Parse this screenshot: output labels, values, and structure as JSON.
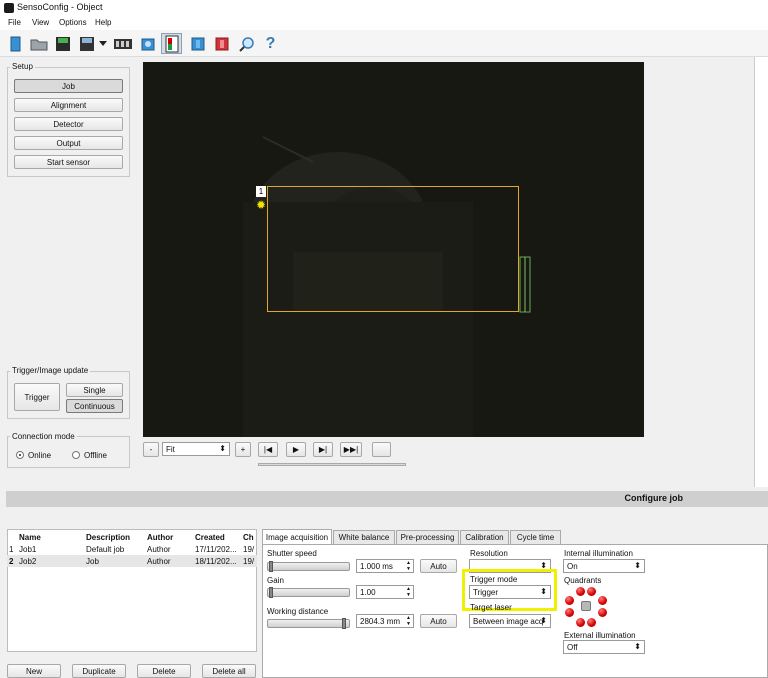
{
  "window": {
    "title": "SensoConfig - Object"
  },
  "menu": [
    "File",
    "View",
    "Options",
    "Help"
  ],
  "toolbar": {
    "icons": [
      "new-job-icon",
      "open-icon",
      "save-icon",
      "save-as-icon",
      "dropdown-icon",
      "film-icon",
      "camera-icon",
      "object-icon",
      "color-icon",
      "book-icon",
      "search-icon",
      "help-icon"
    ]
  },
  "setup": {
    "title": "Setup",
    "buttons": [
      "Job",
      "Alignment",
      "Detector",
      "Output",
      "Start sensor"
    ]
  },
  "trigger": {
    "title": "Trigger/Image update",
    "trigger_label": "Trigger",
    "single_label": "Single",
    "continuous_label": "Continuous"
  },
  "connection": {
    "title": "Connection mode",
    "online": "Online",
    "offline": "Offline"
  },
  "viewer": {
    "roi_number": "1",
    "zoom_value": "Fit",
    "minus": "-",
    "plus": "+"
  },
  "section": {
    "title": "Configure job"
  },
  "jobs": {
    "columns": [
      "",
      "Name",
      "Description",
      "Author",
      "Created",
      "Ch"
    ],
    "rows": [
      [
        "1",
        "Job1",
        "Default job",
        "Author",
        "17/11/202...",
        "19/"
      ],
      [
        "2",
        "Job2",
        "Job",
        "Author",
        "18/11/202...",
        "19/"
      ]
    ],
    "buttons": {
      "new": "New",
      "duplicate": "Duplicate",
      "delete": "Delete",
      "delete_all": "Delete all"
    }
  },
  "tabs": [
    "Image acquisition",
    "White balance",
    "Pre-processing",
    "Calibration",
    "Cycle time"
  ],
  "acquisition": {
    "shutter_label": "Shutter speed",
    "shutter_value": "1.000 ms",
    "gain_label": "Gain",
    "gain_value": "1.00",
    "working_distance_label": "Working distance",
    "working_distance_value": "2804.3 mm",
    "auto": "Auto",
    "resolution_label": "Resolution",
    "trigger_mode_label": "Trigger mode",
    "trigger_mode_value": "Trigger",
    "target_laser_label": "Target laser",
    "target_laser_value": "Between image acq",
    "internal_illum_label": "Internal illumination",
    "internal_illum_value": "On",
    "quadrants_label": "Quadrants",
    "external_illum_label": "External illumination",
    "external_illum_value": "Off"
  },
  "colors": {
    "highlight": "#f0f000",
    "roi": "#e0a82a",
    "quadrant": "#d40000"
  }
}
